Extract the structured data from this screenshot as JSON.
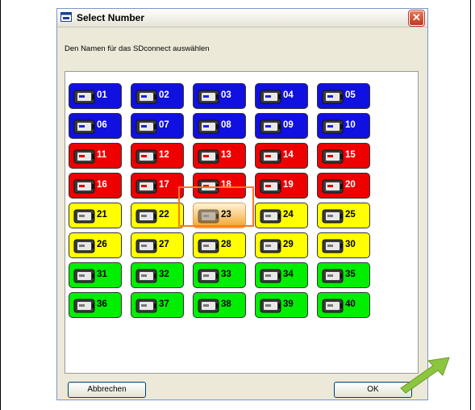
{
  "dialog": {
    "title": "Select Number",
    "subtitle": "Den Namen für das SDconnect auswählen",
    "close_label": "✕",
    "cancel_label": "Abbrechen",
    "ok_label": "OK"
  },
  "colors": {
    "blue": "#1010e0",
    "red": "#ee0000",
    "yellow": "#ffff00",
    "green": "#00ee00",
    "selected_orange": "#f5a32a",
    "selection_frame": "#ff7a1a",
    "arrow": "#8cc63e"
  },
  "tiles": [
    {
      "label": "01",
      "color": "blue"
    },
    {
      "label": "02",
      "color": "blue"
    },
    {
      "label": "03",
      "color": "blue"
    },
    {
      "label": "04",
      "color": "blue"
    },
    {
      "label": "05",
      "color": "blue"
    },
    {
      "label": "06",
      "color": "blue"
    },
    {
      "label": "07",
      "color": "blue"
    },
    {
      "label": "08",
      "color": "blue"
    },
    {
      "label": "09",
      "color": "blue"
    },
    {
      "label": "10",
      "color": "blue"
    },
    {
      "label": "11",
      "color": "red"
    },
    {
      "label": "12",
      "color": "red"
    },
    {
      "label": "13",
      "color": "red"
    },
    {
      "label": "14",
      "color": "red"
    },
    {
      "label": "15",
      "color": "red"
    },
    {
      "label": "16",
      "color": "red"
    },
    {
      "label": "17",
      "color": "red"
    },
    {
      "label": "18",
      "color": "red"
    },
    {
      "label": "19",
      "color": "red"
    },
    {
      "label": "20",
      "color": "red"
    },
    {
      "label": "21",
      "color": "yellow"
    },
    {
      "label": "22",
      "color": "yellow"
    },
    {
      "label": "23",
      "color": "yellow",
      "selected": true
    },
    {
      "label": "24",
      "color": "yellow"
    },
    {
      "label": "25",
      "color": "yellow"
    },
    {
      "label": "26",
      "color": "yellow"
    },
    {
      "label": "27",
      "color": "yellow"
    },
    {
      "label": "28",
      "color": "yellow"
    },
    {
      "label": "29",
      "color": "yellow"
    },
    {
      "label": "30",
      "color": "yellow"
    },
    {
      "label": "31",
      "color": "green"
    },
    {
      "label": "32",
      "color": "green"
    },
    {
      "label": "33",
      "color": "green"
    },
    {
      "label": "34",
      "color": "green"
    },
    {
      "label": "35",
      "color": "green"
    },
    {
      "label": "36",
      "color": "green"
    },
    {
      "label": "37",
      "color": "green"
    },
    {
      "label": "38",
      "color": "green"
    },
    {
      "label": "39",
      "color": "green"
    },
    {
      "label": "40",
      "color": "green"
    }
  ],
  "icons": {
    "title": "window-icon",
    "tile": "sdconnect-device-icon",
    "pointer": "green-arrow-icon"
  }
}
